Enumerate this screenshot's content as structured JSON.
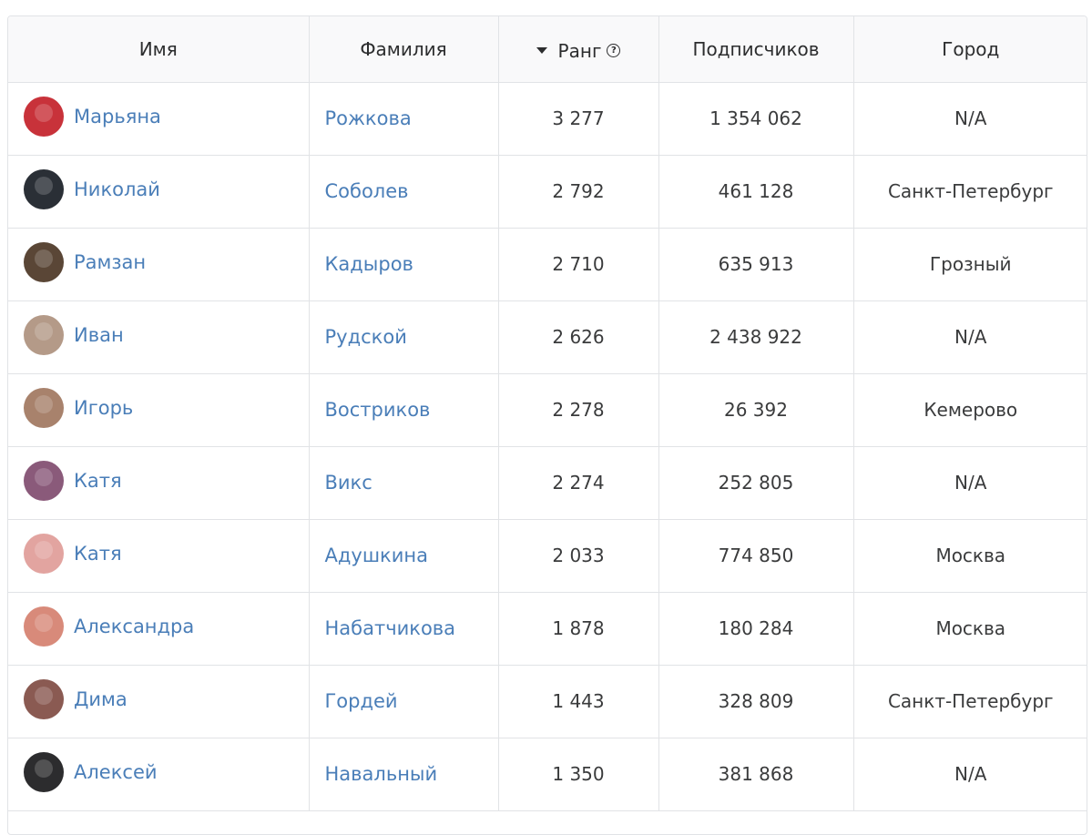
{
  "columns": {
    "name": "Имя",
    "surname": "Фамилия",
    "rank": "Ранг",
    "subscribers": "Подписчиков",
    "city": "Город"
  },
  "sort": {
    "column": "rank",
    "direction": "desc"
  },
  "colors": {
    "link": "#4a7eb8",
    "header_bg": "#f9f9fa",
    "border": "#e1e3e6",
    "text": "#3a3b3c"
  },
  "rows": [
    {
      "first": "Марьяна",
      "last": "Рожкова",
      "rank": "3 277",
      "subscribers": "1 354 062",
      "city": "N/A",
      "avatar_color": "#c8323a"
    },
    {
      "first": "Николай",
      "last": "Соболев",
      "rank": "2 792",
      "subscribers": "461 128",
      "city": "Санкт-Петербург",
      "avatar_color": "#2a2f36"
    },
    {
      "first": "Рамзан",
      "last": "Кадыров",
      "rank": "2 710",
      "subscribers": "635 913",
      "city": "Грозный",
      "avatar_color": "#5a4636"
    },
    {
      "first": "Иван",
      "last": "Рудской",
      "rank": "2 626",
      "subscribers": "2 438 922",
      "city": "N/A",
      "avatar_color": "#b49a88"
    },
    {
      "first": "Игорь",
      "last": "Востриков",
      "rank": "2 278",
      "subscribers": "26 392",
      "city": "Кемерово",
      "avatar_color": "#a8826c"
    },
    {
      "first": "Катя",
      "last": "Викс",
      "rank": "2 274",
      "subscribers": "252 805",
      "city": "N/A",
      "avatar_color": "#8a5a7a"
    },
    {
      "first": "Катя",
      "last": "Адушкина",
      "rank": "2 033",
      "subscribers": "774 850",
      "city": "Москва",
      "avatar_color": "#e2a4a0"
    },
    {
      "first": "Александра",
      "last": "Набатчикова",
      "rank": "1 878",
      "subscribers": "180 284",
      "city": "Москва",
      "avatar_color": "#d88a7a"
    },
    {
      "first": "Дима",
      "last": "Гордей",
      "rank": "1 443",
      "subscribers": "328 809",
      "city": "Санкт-Петербург",
      "avatar_color": "#8a5a52"
    },
    {
      "first": "Алексей",
      "last": "Навальный",
      "rank": "1 350",
      "subscribers": "381 868",
      "city": "N/A",
      "avatar_color": "#2c2c2e"
    }
  ]
}
